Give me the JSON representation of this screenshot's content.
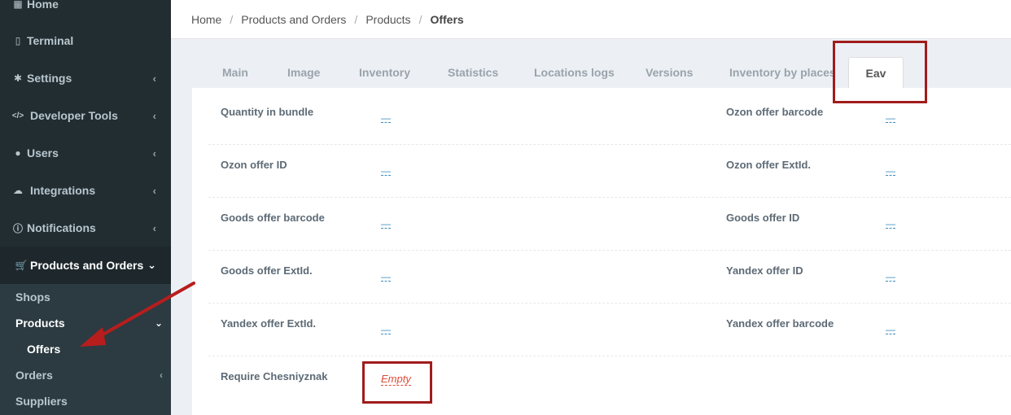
{
  "sidebar": {
    "items": [
      {
        "label": "Home",
        "icon": "grid-icon"
      },
      {
        "label": "Terminal",
        "icon": "tablet-icon"
      },
      {
        "label": "Settings",
        "icon": "gear-icon"
      },
      {
        "label": "Developer Tools",
        "icon": "code-icon"
      },
      {
        "label": "Users",
        "icon": "user-icon"
      },
      {
        "label": "Integrations",
        "icon": "cloud-icon"
      },
      {
        "label": "Notifications",
        "icon": "info-icon"
      },
      {
        "label": "Products and Orders",
        "icon": "cart-icon"
      }
    ],
    "subitems": [
      {
        "label": "Shops"
      },
      {
        "label": "Products"
      },
      {
        "label": "Offers"
      },
      {
        "label": "Orders"
      },
      {
        "label": "Suppliers"
      }
    ]
  },
  "breadcrumb": [
    "Home",
    "Products and Orders",
    "Products",
    "Offers"
  ],
  "tabs": [
    "Main",
    "Image",
    "Inventory",
    "Statistics",
    "Locations logs",
    "Versions",
    "Inventory by places",
    "Eav"
  ],
  "fields": [
    {
      "label": "Quantity in bundle",
      "value": "—"
    },
    {
      "label": "Ozon offer barcode",
      "value": "—"
    },
    {
      "label": "Ozon offer ID",
      "value": "—"
    },
    {
      "label": "Ozon offer ExtId.",
      "value": "—"
    },
    {
      "label": "Goods offer barcode",
      "value": "—"
    },
    {
      "label": "Goods offer ID",
      "value": "—"
    },
    {
      "label": "Goods offer ExtId.",
      "value": "—"
    },
    {
      "label": "Yandex offer ID",
      "value": "—"
    },
    {
      "label": "Yandex offer ExtId.",
      "value": "—"
    },
    {
      "label": "Yandex offer barcode",
      "value": "—"
    },
    {
      "label": "Require Chesniyznak",
      "value": "Empty"
    }
  ],
  "colors": {
    "sidebar": "#222d32",
    "link": "#3c8dbc",
    "empty": "#dd4b39",
    "annotation": "#a01c1c"
  }
}
